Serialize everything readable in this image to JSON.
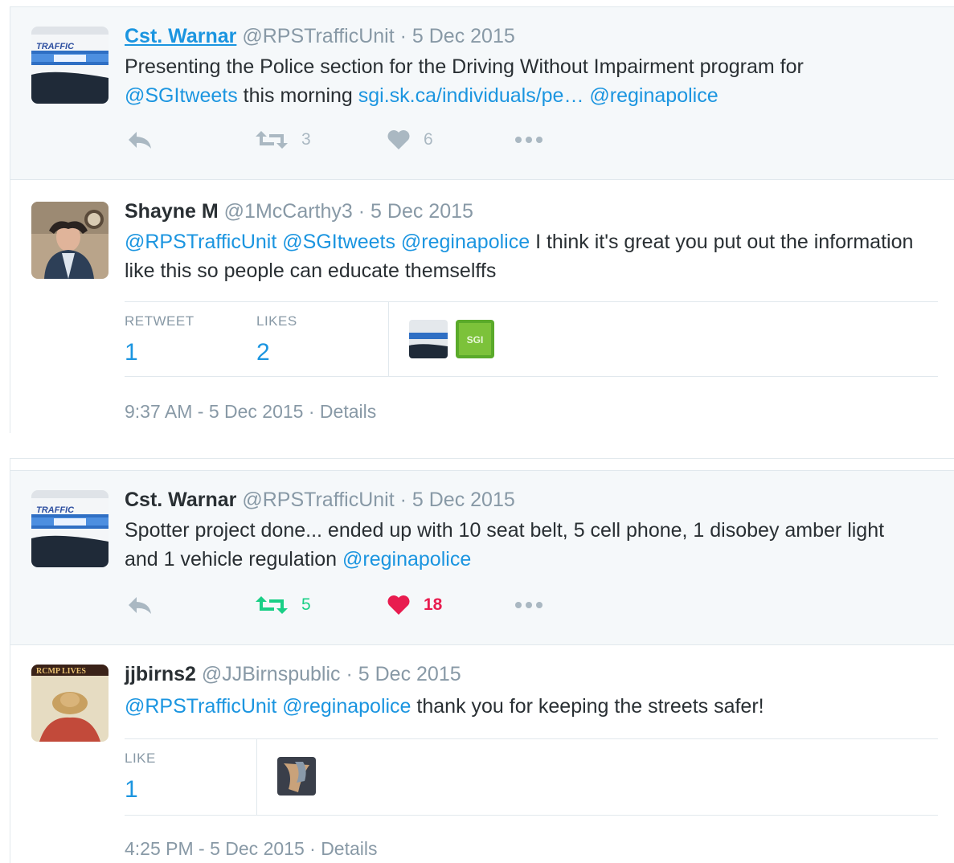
{
  "thread1": {
    "parent": {
      "name": "Cst. Warnar",
      "handle": "@RPSTrafficUnit",
      "sep": "·",
      "date": "5 Dec 2015",
      "text_1": "Presenting the Police section for the Driving Without Impairment  program for",
      "mention_1": "@SGItweets",
      "text_2": "  this morning ",
      "link": "sgi.sk.ca/individuals/pe…",
      "text_3": " ",
      "mention_2": "@reginapolice",
      "retweets": "3",
      "likes": "6"
    },
    "reply": {
      "name": "Shayne M",
      "handle": "@1McCarthy3",
      "sep": "·",
      "date": "5 Dec 2015",
      "mention_1": "@RPSTrafficUnit",
      "mention_2": "@SGItweets",
      "mention_3": "@reginapolice",
      "text_1": " I think it's great you put out the information like this so people can educate themselffs",
      "stat1_label": "RETWEET",
      "stat1_value": "1",
      "stat2_label": "LIKES",
      "stat2_value": "2",
      "time": "9:37 AM - 5 Dec 2015",
      "details": "Details"
    }
  },
  "thread2": {
    "parent": {
      "name": "Cst. Warnar",
      "handle": "@RPSTrafficUnit",
      "sep": "·",
      "date": "5 Dec 2015",
      "text_1": "Spotter project done... ended up with 10 seat belt, 5 cell phone, 1 disobey amber light and 1 vehicle regulation ",
      "mention_1": "@reginapolice",
      "retweets": "5",
      "likes": "18"
    },
    "reply": {
      "name": "jjbirns2",
      "handle": "@JJBirnspublic",
      "sep": "·",
      "date": "5 Dec 2015",
      "mention_1": "@RPSTrafficUnit",
      "mention_2": "@reginapolice",
      "text_1": " thank you for keeping the streets safer!",
      "stat1_label": "LIKE",
      "stat1_value": "1",
      "time": "4:25 PM - 5 Dec 2015",
      "details": "Details",
      "avatar_banner": "RCMP LIVES"
    }
  },
  "avatar_logo_text": "TRAFFIC",
  "sgi_logo_text": "SGI",
  "icons": {
    "reply": "reply-icon",
    "retweet": "retweet-icon",
    "like": "heart-icon",
    "more": "more-icon"
  },
  "colors": {
    "link": "#1b95e0",
    "muted": "#8899a6",
    "retweet_active": "#19cf86",
    "like_active": "#e81c4f",
    "parent_bg": "#f5f8fa"
  }
}
